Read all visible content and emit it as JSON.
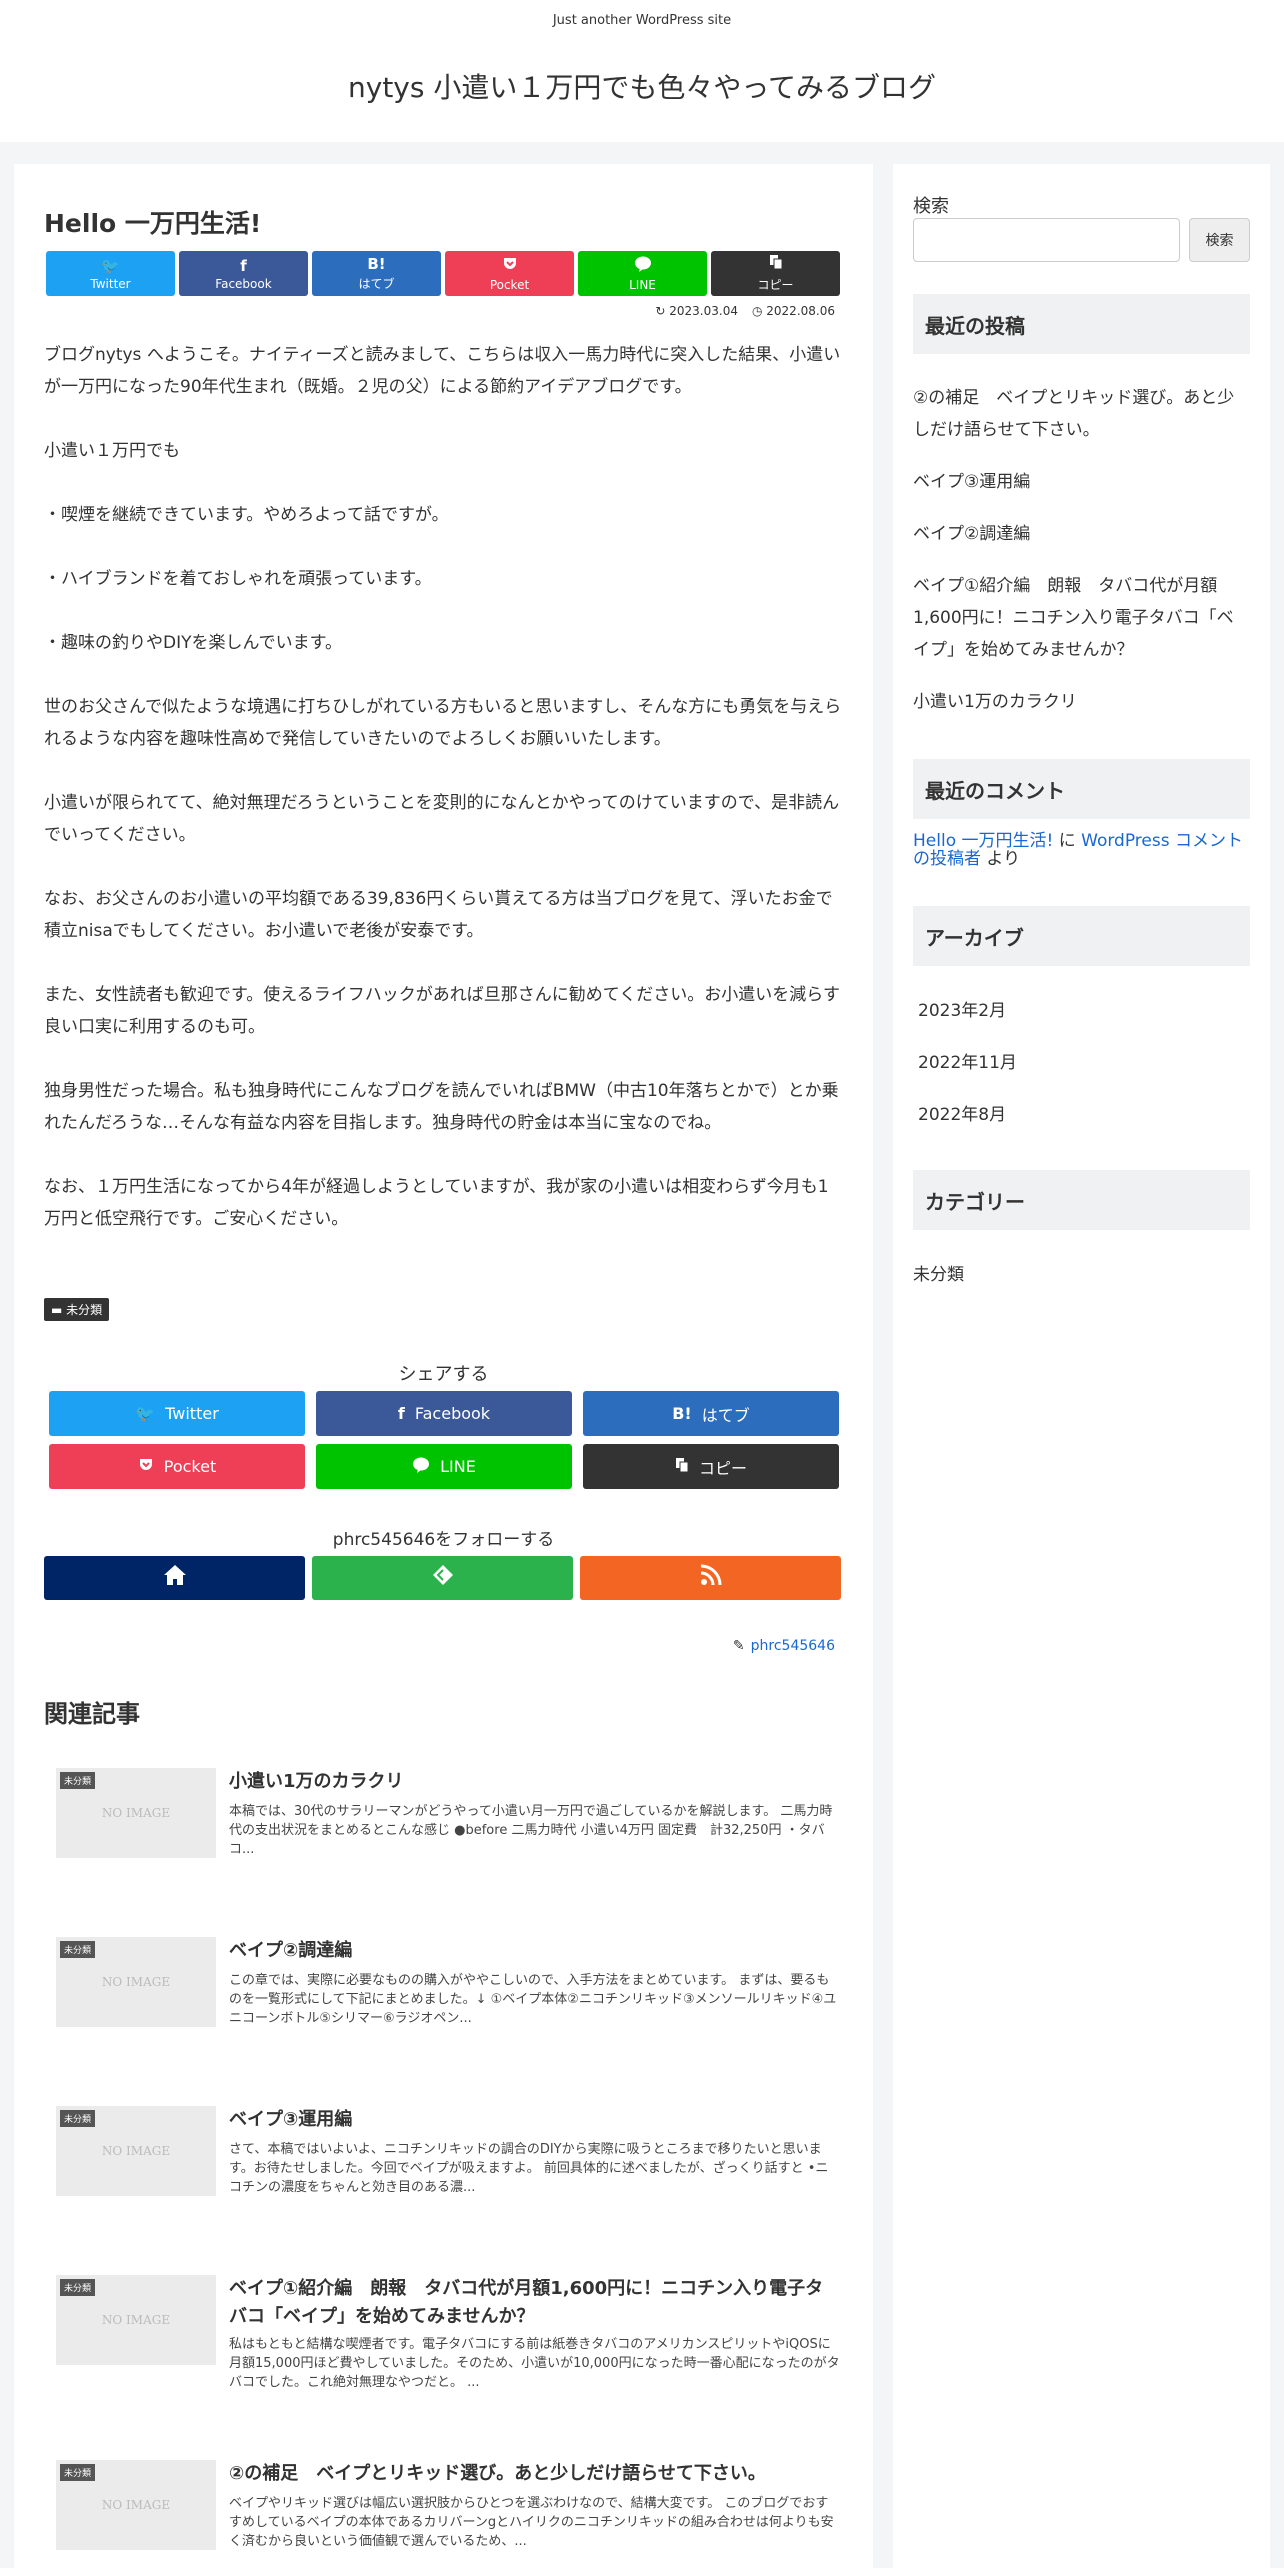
{
  "header": {
    "tagline": "Just another WordPress site",
    "site_title": "nytys 小遣い１万円でも色々やってみるブログ"
  },
  "post": {
    "title": "Hello 一万円生活!",
    "share_top": [
      {
        "label": "Twitter",
        "icon": "twitter-icon",
        "glyph": "🐦"
      },
      {
        "label": "Facebook",
        "icon": "facebook-icon",
        "glyph": "f"
      },
      {
        "label": "はてブ",
        "icon": "hatebu-icon",
        "glyph": "B!"
      },
      {
        "label": "Pocket",
        "icon": "pocket-icon",
        "glyph": "⛉"
      },
      {
        "label": "LINE",
        "icon": "line-icon",
        "glyph": "💬"
      },
      {
        "label": "コピー",
        "icon": "copy-icon",
        "glyph": "⎘"
      }
    ],
    "updated_date": "2023.03.04",
    "published_date": "2022.08.06",
    "paragraphs": [
      "ブログnytys へようこそ。ナイティーズと読みまして、こちらは収入一馬力時代に突入した結果、小遣いが一万円になった90年代生まれ（既婚。２児の父）による節約アイデアブログです。",
      "小遣い１万円でも",
      "・喫煙を継続できています。やめろよって話ですが。",
      "・ハイブランドを着ておしゃれを頑張っています。",
      "・趣味の釣りやDIYを楽しんでいます。",
      "世のお父さんで似たような境遇に打ちひしがれている方もいると思いますし、そんな方にも勇気を与えられるような内容を趣味性高めで発信していきたいのでよろしくお願いいたします。",
      "小遣いが限られてて、絶対無理だろうということを変則的になんとかやってのけていますので、是非読んでいってください。",
      "なお、お父さんのお小遣いの平均額である39,836円くらい貰えてる方は当ブログを見て、浮いたお金で積立nisaでもしてください。お小遣いで老後が安泰です。",
      "また、女性読者も歓迎です。使えるライフハックがあれば旦那さんに勧めてください。お小遣いを減らす良い口実に利用するのも可。",
      "独身男性だった場合。私も独身時代にこんなブログを読んでいればBMW（中古10年落ちとかで）とか乗れたんだろうな…そんな有益な内容を目指します。独身時代の貯金は本当に宝なのでね。",
      "なお、１万円生活になってから4年が経過しようとしていますが、我が家の小遣いは相変わらず今月も1万円と低空飛行です。ご安心ください。"
    ],
    "category": "未分類",
    "share_title": "シェアする",
    "share_bottom": [
      {
        "label": "Twitter",
        "icon": "twitter-icon",
        "glyph": "🐦"
      },
      {
        "label": "Facebook",
        "icon": "facebook-icon",
        "glyph": "f"
      },
      {
        "label": "はてブ",
        "icon": "hatebu-icon",
        "glyph": "B!"
      },
      {
        "label": "Pocket",
        "icon": "pocket-icon",
        "glyph": "⛉"
      },
      {
        "label": "LINE",
        "icon": "line-icon",
        "glyph": "💬"
      },
      {
        "label": "コピー",
        "icon": "copy-icon",
        "glyph": "⎘"
      }
    ],
    "follow_title": "phrc545646をフォローする",
    "author": "phrc545646"
  },
  "related": {
    "title": "関連記事",
    "no_image": "NO IMAGE",
    "items": [
      {
        "category": "未分類",
        "title": "小遣い1万のカラクリ",
        "snippet": "本稿では、30代のサラリーマンがどうやって小遣い月一万円で過ごしているかを解説します。 二馬力時代の支出状況をまとめるとこんな感じ ●before 二馬力時代 小遣い4万円 固定費　計32,250円 ・タバコ..."
      },
      {
        "category": "未分類",
        "title": "ベイプ②調達編",
        "snippet": "この章では、実際に必要なものの購入がややこしいので、入手方法をまとめています。 まずは、要るものを一覧形式にして下記にまとめました。↓ ①ベイプ本体②ニコチンリキッド③メンソールリキッド④ユニコーンボトル⑤シリマー⑥ラジオペン..."
      },
      {
        "category": "未分類",
        "title": "ベイプ③運用編",
        "snippet": "さて、本稿ではいよいよ、ニコチンリキッドの調合のDIYから実際に吸うところまで移りたいと思います。お待たせしました。今回でベイプが吸えますよ。 前回具体的に述べましたが、ざっくり話すと •ニコチンの濃度をちゃんと効き目のある濃..."
      },
      {
        "category": "未分類",
        "title": "ベイプ①紹介編　朗報　タバコ代が月額1,600円に！ニコチン入り電子タバコ「ベイプ」を始めてみませんか？",
        "snippet": "私はもともと結構な喫煙者です。電子タバコにする前は紙巻きタバコのアメリカンスピリットやiQOSに月額15,000円ほど費やしていました。そのため、小遣いが10,000円になった時一番心配になったのがタバコでした。これ絶対無理なやつだと。 ..."
      },
      {
        "category": "未分類",
        "title": "②の補足　ベイプとリキッド選び。あと少しだけ語らせて下さい。",
        "snippet": "ベイプやリキッド選びは幅広い選択肢からひとつを選ぶわけなので、結構大変です。 このブログでおすすめしているベイプの本体であるカリバーンgとハイリクのニコチンリキッドの組み合わせは何よりも安く済むから良いという価値観で選んでいるため、..."
      }
    ]
  },
  "sidebar": {
    "search_label": "検索",
    "search_placeholder": "",
    "search_button": "検索",
    "recent_posts_title": "最近の投稿",
    "recent_posts": [
      "②の補足　ベイプとリキッド選び。あと少しだけ語らせて下さい。",
      "ベイプ③運用編",
      "ベイプ②調達編",
      "ベイプ①紹介編　朗報　タバコ代が月額1,600円に！ニコチン入り電子タバコ「ベイプ」を始めてみませんか？",
      "小遣い1万のカラクリ"
    ],
    "recent_comments_title": "最近のコメント",
    "comment_post": "Hello 一万円生活!",
    "comment_ni": " に ",
    "comment_author": "WordPress コメントの投稿者",
    "comment_yori": " より",
    "archives_title": "アーカイブ",
    "archives": [
      "2023年2月",
      "2022年11月",
      "2022年8月"
    ],
    "categories_title": "カテゴリー",
    "categories": [
      "未分類"
    ]
  },
  "colors": {
    "twitter": "#1da1f2",
    "facebook": "#3b5998",
    "hatebu": "#2c6ebd",
    "pocket": "#ef3f56",
    "line": "#00c300",
    "copy": "#333333",
    "follow_home": "#002567",
    "follow_feedly": "#2bb24c",
    "follow_rss": "#f26522"
  }
}
